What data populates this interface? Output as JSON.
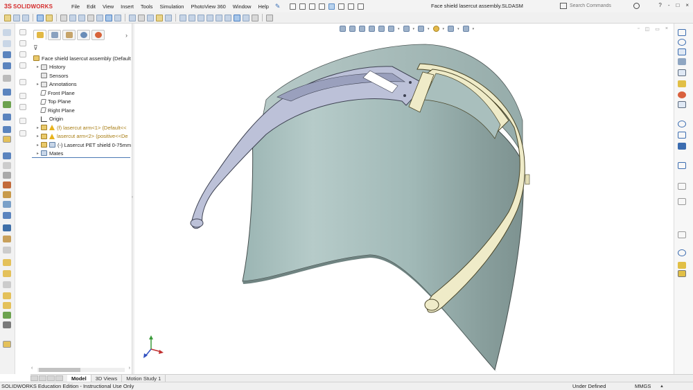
{
  "app": {
    "brand": "SOLIDWORKS",
    "brand_mark": "3S",
    "document_title": "Face shield lasercut assembly.SLDASM"
  },
  "menu": [
    "File",
    "Edit",
    "View",
    "Insert",
    "Tools",
    "Simulation",
    "PhotoView 360",
    "Window",
    "Help"
  ],
  "search": {
    "placeholder": "Search Commands"
  },
  "window_buttons": [
    "?",
    "-",
    "□",
    "×"
  ],
  "viewport_buttons": [
    "▫",
    "◫",
    "▭",
    "×"
  ],
  "feature_tree": {
    "root": "Face shield lasercut assembly  (Default",
    "items": [
      {
        "label": "History",
        "icon": "history-folder-icon"
      },
      {
        "label": "Sensors",
        "icon": "sensors-folder-icon"
      },
      {
        "label": "Annotations",
        "icon": "annotations-icon"
      },
      {
        "label": "Front Plane",
        "icon": "plane-icon"
      },
      {
        "label": "Top Plane",
        "icon": "plane-icon"
      },
      {
        "label": "Right Plane",
        "icon": "plane-icon"
      },
      {
        "label": "Origin",
        "icon": "origin-icon"
      },
      {
        "label": "(f) lasercut arm<1> (Default<<",
        "icon": "warning-icon"
      },
      {
        "label": "lasercut arm<2> (positive<<De",
        "icon": "warning-icon"
      },
      {
        "label": "(-) Lasercut PET shield 0-75mm",
        "icon": "part-icon"
      },
      {
        "label": "Mates",
        "icon": "mates-icon"
      }
    ]
  },
  "bottom_tabs": [
    {
      "label": "Model",
      "active": true
    },
    {
      "label": "3D Views",
      "active": false
    },
    {
      "label": "Motion Study 1",
      "active": false
    }
  ],
  "status": {
    "left": "SOLIDWORKS Education Edition - Instructional Use Only",
    "state": "Under Defined",
    "units": "MMGS",
    "units_dropdown": "▲"
  },
  "colors": {
    "shield": "#a9c1bf",
    "arm_blue": "#b9bfd6",
    "arm_yellow": "#eeeac5",
    "brand_red": "#d42b2b",
    "accent_blue": "#4a78b3"
  }
}
